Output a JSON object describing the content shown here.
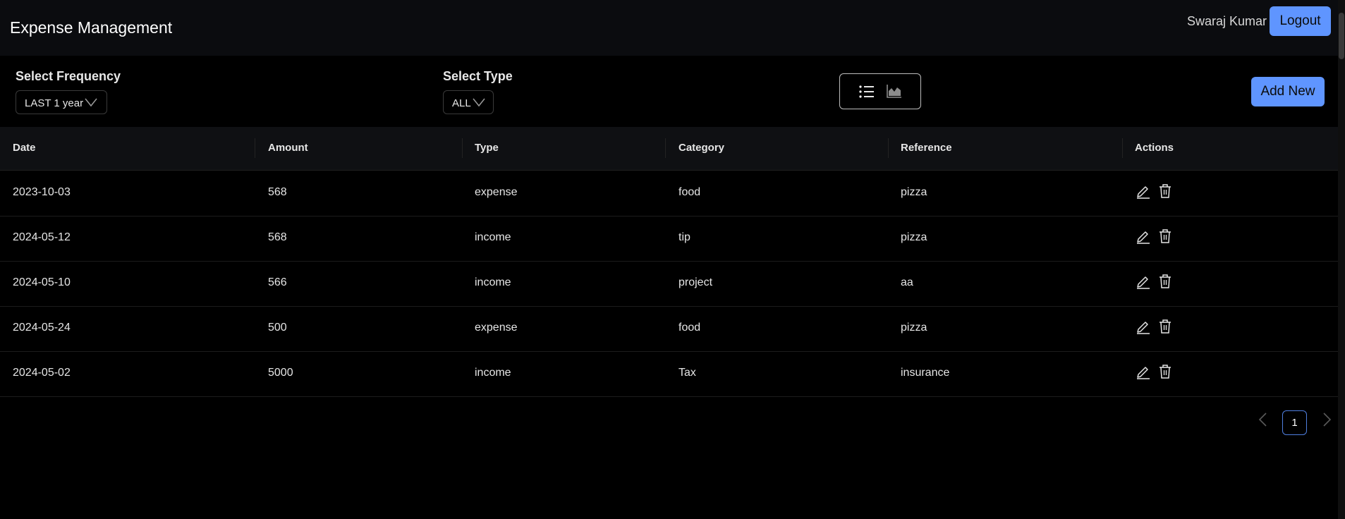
{
  "header": {
    "title": "Expense Management",
    "user": "Swaraj Kumar",
    "logout_label": "Logout"
  },
  "filters": {
    "frequency": {
      "label": "Select Frequency",
      "value": "LAST 1 year"
    },
    "type": {
      "label": "Select Type",
      "value": "ALL"
    }
  },
  "view_toggle": {
    "icons": [
      "list-icon",
      "area-chart-icon"
    ]
  },
  "add_new_label": "Add New",
  "table": {
    "headers": [
      "Date",
      "Amount",
      "Type",
      "Category",
      "Reference",
      "Actions"
    ],
    "rows": [
      {
        "date": "2023-10-03",
        "amount": "568",
        "type": "expense",
        "category": "food",
        "reference": "pizza"
      },
      {
        "date": "2024-05-12",
        "amount": "568",
        "type": "income",
        "category": "tip",
        "reference": "pizza"
      },
      {
        "date": "2024-05-10",
        "amount": "566",
        "type": "income",
        "category": "project",
        "reference": "aa"
      },
      {
        "date": "2024-05-24",
        "amount": "500",
        "type": "expense",
        "category": "food",
        "reference": "pizza"
      },
      {
        "date": "2024-05-02",
        "amount": "5000",
        "type": "income",
        "category": "Tax",
        "reference": "insurance"
      }
    ],
    "action_icons": [
      "edit-icon",
      "delete-icon"
    ]
  },
  "pagination": {
    "current_page": "1"
  },
  "colors": {
    "accent": "#5f95ff",
    "background": "#000000",
    "navbar": "#0b0c0f"
  }
}
